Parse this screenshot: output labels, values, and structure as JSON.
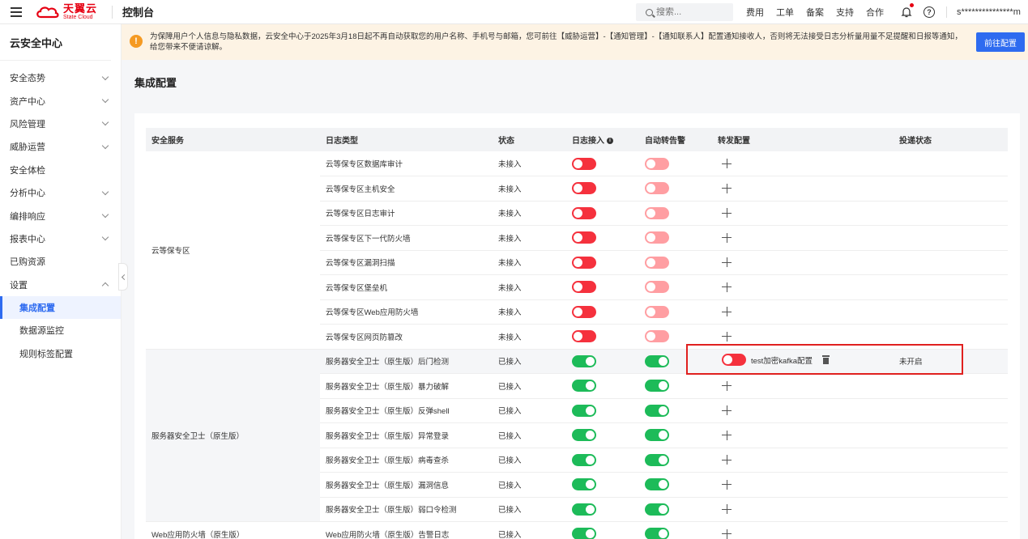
{
  "topbar": {
    "brand_cn": "天翼云",
    "brand_en": "State Cloud",
    "console_label": "控制台",
    "search_placeholder": "搜索...",
    "links": [
      "费用",
      "工单",
      "备案",
      "支持",
      "合作"
    ],
    "account": "s***************m"
  },
  "sidebar": {
    "title": "云安全中心",
    "items": [
      {
        "label": "安全态势",
        "expandable": true
      },
      {
        "label": "资产中心",
        "expandable": true
      },
      {
        "label": "风险管理",
        "expandable": true
      },
      {
        "label": "威胁运营",
        "expandable": true
      },
      {
        "label": "安全体检",
        "expandable": false
      },
      {
        "label": "分析中心",
        "expandable": true
      },
      {
        "label": "编排响应",
        "expandable": true
      },
      {
        "label": "报表中心",
        "expandable": true
      },
      {
        "label": "已购资源",
        "expandable": false
      },
      {
        "label": "设置",
        "expandable": true,
        "expanded": true
      }
    ],
    "subitems": [
      {
        "label": "集成配置",
        "active": true
      },
      {
        "label": "数据源监控",
        "active": false
      },
      {
        "label": "规则标签配置",
        "active": false
      }
    ]
  },
  "notice": {
    "text": "为保障用户个人信息与隐私数据，云安全中心于2025年3月18日起不再自动获取您的用户名称、手机号与邮箱，您可前往【威胁运营】-【通知管理】-【通知联系人】配置通知接收人，否则将无法接受日志分析量用量不足提醒和日报等通知，给您带来不便请谅解。",
    "button": "前往配置"
  },
  "page_title": "集成配置",
  "table": {
    "headers": [
      "安全服务",
      "日志类型",
      "状态",
      "日志接入",
      "自动转告警",
      "转发配置",
      "投递状态"
    ],
    "groups": [
      {
        "service": "云等保专区",
        "rows": [
          {
            "log_type": "云等保专区数据库审计",
            "status": "未接入",
            "log_access": false,
            "auto_alert": false
          },
          {
            "log_type": "云等保专区主机安全",
            "status": "未接入",
            "log_access": false,
            "auto_alert": false
          },
          {
            "log_type": "云等保专区日志审计",
            "status": "未接入",
            "log_access": false,
            "auto_alert": false
          },
          {
            "log_type": "云等保专区下一代防火墙",
            "status": "未接入",
            "log_access": false,
            "auto_alert": false
          },
          {
            "log_type": "云等保专区漏洞扫描",
            "status": "未接入",
            "log_access": false,
            "auto_alert": false
          },
          {
            "log_type": "云等保专区堡垒机",
            "status": "未接入",
            "log_access": false,
            "auto_alert": false
          },
          {
            "log_type": "云等保专区Web应用防火墙",
            "status": "未接入",
            "log_access": false,
            "auto_alert": false
          },
          {
            "log_type": "云等保专区网页防篡改",
            "status": "未接入",
            "log_access": false,
            "auto_alert": false
          }
        ]
      },
      {
        "service": "服务器安全卫士（原生版）",
        "rows": [
          {
            "log_type": "服务器安全卫士（原生版）后门检测",
            "status": "已接入",
            "log_access": true,
            "auto_alert": true,
            "forward": {
              "enabled": false,
              "name": "test加密kafka配置"
            },
            "delivery_status": "未开启"
          },
          {
            "log_type": "服务器安全卫士（原生版）暴力破解",
            "status": "已接入",
            "log_access": true,
            "auto_alert": true
          },
          {
            "log_type": "服务器安全卫士（原生版）反弹shell",
            "status": "已接入",
            "log_access": true,
            "auto_alert": true
          },
          {
            "log_type": "服务器安全卫士（原生版）异常登录",
            "status": "已接入",
            "log_access": true,
            "auto_alert": true
          },
          {
            "log_type": "服务器安全卫士（原生版）病毒查杀",
            "status": "已接入",
            "log_access": true,
            "auto_alert": true
          },
          {
            "log_type": "服务器安全卫士（原生版）漏洞信息",
            "status": "已接入",
            "log_access": true,
            "auto_alert": true
          },
          {
            "log_type": "服务器安全卫士（原生版）弱口令检测",
            "status": "已接入",
            "log_access": true,
            "auto_alert": true
          }
        ]
      },
      {
        "service": "Web应用防火墙（原生版）",
        "rows": [
          {
            "log_type": "Web应用防火墙（原生版）告警日志",
            "status": "已接入",
            "log_access": true,
            "auto_alert": true
          }
        ]
      }
    ]
  },
  "colors": {
    "accent": "#2e6bf0",
    "toggle_on": "#1dbb59",
    "toggle_off": "#f5313d",
    "toggle_off_disabled": "#ff9ea2",
    "highlight_box": "#e0201f",
    "brand": "#e60012"
  }
}
